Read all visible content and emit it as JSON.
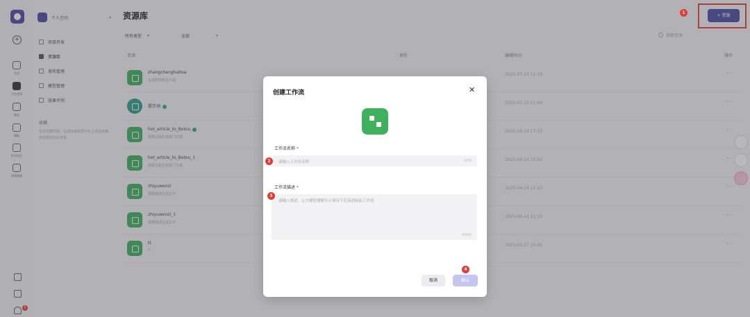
{
  "rail": {
    "items": [
      {
        "label": "主页",
        "icon": "home-icon"
      },
      {
        "label": "工作空间",
        "icon": "folder-icon"
      },
      {
        "label": "商店",
        "icon": "store-icon"
      },
      {
        "label": "模板",
        "icon": "grid-icon"
      },
      {
        "label": "扣子社区",
        "icon": "community-icon"
      },
      {
        "label": "资源管理",
        "icon": "briefcase-icon"
      }
    ],
    "notification_count": "3"
  },
  "sidebar": {
    "workspace_name": "个人空间",
    "items": [
      {
        "label": "项目开发"
      },
      {
        "label": "资源库"
      },
      {
        "label": "发布管理"
      },
      {
        "label": "模型管理"
      },
      {
        "label": "效果评测"
      }
    ],
    "section_title": "收藏",
    "section_tip": "暂无收藏内容，在项目或资源卡片上点击收藏按钮即可在此查看"
  },
  "header": {
    "title": "资源库",
    "add_button": "+ 资源",
    "filter_type": "所有类型",
    "filter_scope": "全部",
    "search_placeholder": "搜索资源"
  },
  "table": {
    "columns": [
      "资源",
      "类型",
      "编辑时间",
      "操作"
    ],
    "rows": [
      {
        "name": "zhangchenghaitea",
        "desc": "生成旅游景点介绍",
        "time": "2025-07-14 11:19",
        "verified": false,
        "icon": "workflow-icon"
      },
      {
        "name": "提示词",
        "desc": "",
        "time": "2025-07-11 11:49",
        "verified": true,
        "icon": "prompt-icon"
      },
      {
        "name": "hot_article_to_Botou",
        "desc": "根据主题生成热门文章",
        "time": "2025-04-14 17:15",
        "verified": true,
        "icon": "workflow-icon"
      },
      {
        "name": "hot_article_to_Botou_1",
        "desc": "根据主题生成热门文章",
        "time": "2025-04-14 10:55",
        "verified": false,
        "icon": "workflow-icon"
      },
      {
        "name": "zhiyuwenzi",
        "desc": "根据描述生成文字",
        "time": "2025-04-14 11:15",
        "verified": false,
        "icon": "workflow-icon"
      },
      {
        "name": "zhiyuwenzi_1",
        "desc": "根据描述生成文字",
        "time": "2025-04-14 11:19",
        "verified": false,
        "icon": "workflow-icon"
      },
      {
        "name": "tt",
        "desc": "tt",
        "time": "2025-01-27 20:26",
        "verified": false,
        "icon": "workflow-icon"
      }
    ],
    "ops_label": "···"
  },
  "modal": {
    "title": "创建工作流",
    "close_label": "✕",
    "name_label": "工作流名称",
    "name_placeholder": "请输入工作流名称",
    "name_counter": "0/30",
    "desc_label": "工作流描述",
    "desc_placeholder": "请输入描述，让大模型理解什么情况下应该调用此工作流",
    "desc_counter": "0/600",
    "cancel_label": "取消",
    "confirm_label": "确认"
  },
  "steps": [
    "1",
    "2",
    "3",
    "4"
  ],
  "colors": {
    "brand": "#4c4a9e",
    "workflow_green": "#3fb15c",
    "step_red": "#e53935",
    "confirm_disabled": "#c5c6f0"
  }
}
